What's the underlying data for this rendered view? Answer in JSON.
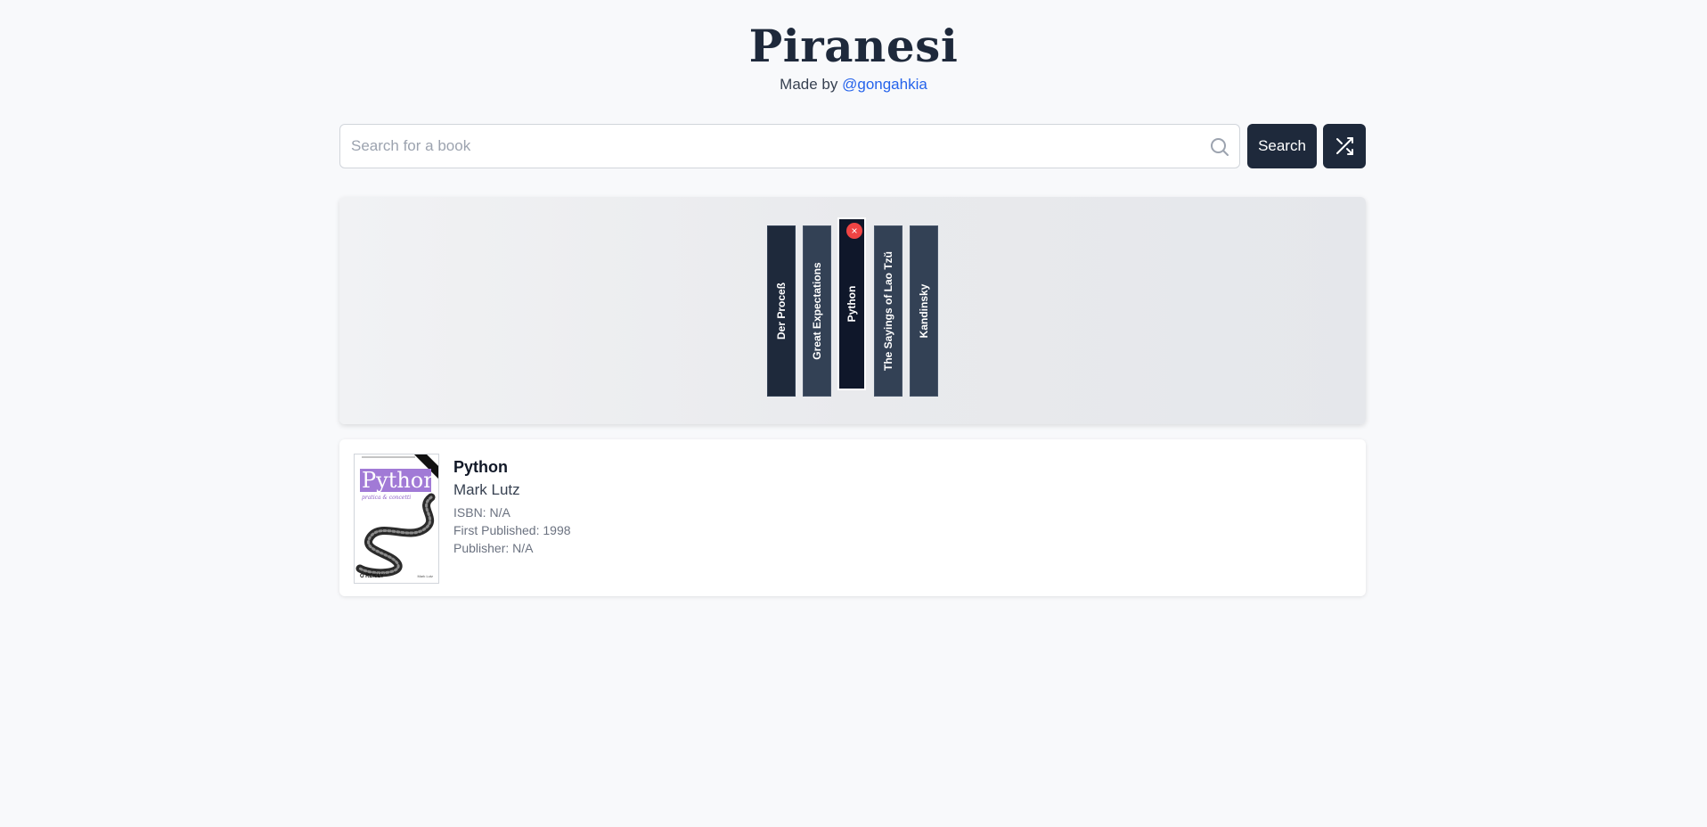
{
  "header": {
    "title": "Piranesi",
    "made_by_prefix": "Made by",
    "author_handle": "@gongahkia"
  },
  "search": {
    "placeholder": "Search for a book",
    "value": "",
    "button_label": "Search",
    "search_icon": "search-icon",
    "shuffle_icon": "shuffle-icon"
  },
  "shelf": {
    "books": [
      {
        "title": "Der Proceß",
        "selected": false
      },
      {
        "title": "Great Expectations",
        "selected": false
      },
      {
        "title": "Python",
        "selected": true
      },
      {
        "title": "The Sayings of Lao Tzŭ",
        "selected": false
      },
      {
        "title": "Kandinsky",
        "selected": false
      }
    ],
    "remove_glyph": "×"
  },
  "detail": {
    "title": "Python",
    "author": "Mark Lutz",
    "isbn": "ISBN: N/A",
    "first_published": "First Published: 1998",
    "publisher": "Publisher: N/A",
    "cover": {
      "word": "Python",
      "subtitle": "pratica & concetti",
      "publisher_mark": "O'REILLY",
      "author_mark": "Mark Lutz"
    }
  },
  "colors": {
    "background": "#f8f9fb",
    "primary_button": "#1e293b",
    "link": "#2563eb",
    "remove_badge": "#ef4444",
    "cover_accent": "#a17ad6"
  }
}
